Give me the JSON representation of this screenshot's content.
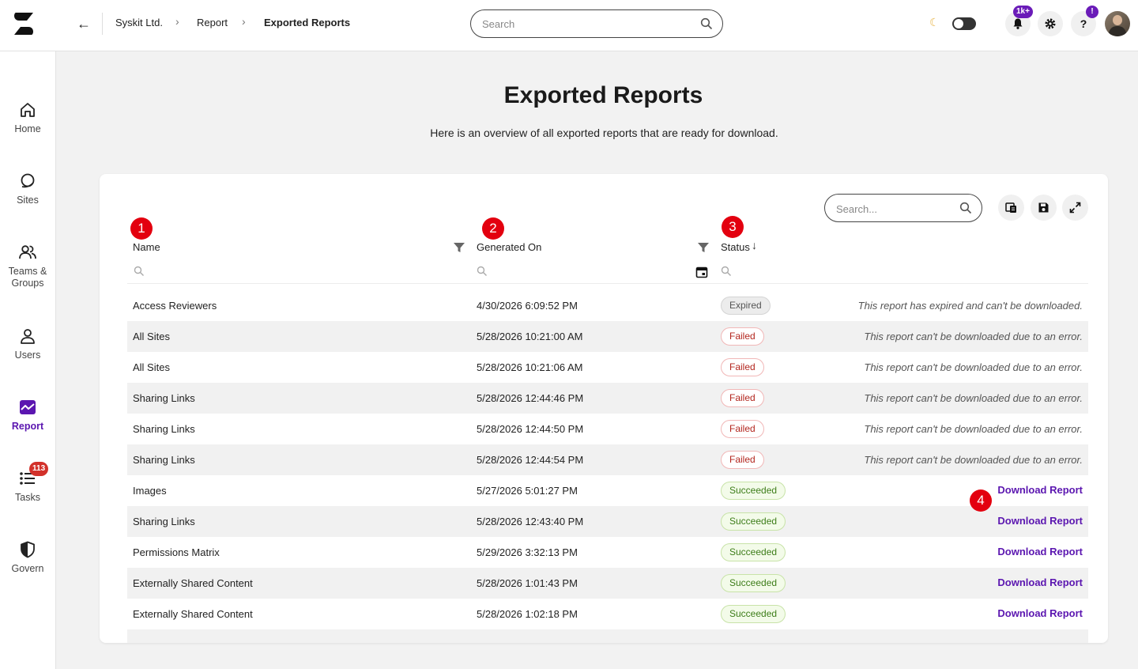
{
  "breadcrumb": {
    "items": [
      "Syskit Ltd.",
      "Report",
      "Exported Reports"
    ]
  },
  "topbar": {
    "search_placeholder": "Search",
    "notifications_badge": "1k+",
    "help_badge": "!",
    "theme": "dark-mode-toggle-off",
    "colors": {
      "accent": "#5b16b0",
      "badge": "#6a1bb8"
    }
  },
  "sidebar": {
    "items": [
      {
        "label": "Home",
        "icon": "home-icon",
        "active": false
      },
      {
        "label": "Sites",
        "icon": "sites-icon",
        "active": false
      },
      {
        "label": "Teams & Groups",
        "icon": "teams-groups-icon",
        "active": false
      },
      {
        "label": "Users",
        "icon": "user-icon",
        "active": false
      },
      {
        "label": "Report",
        "icon": "report-icon",
        "active": true
      },
      {
        "label": "Tasks",
        "icon": "tasks-icon",
        "active": false,
        "badge": "113"
      },
      {
        "label": "Govern",
        "icon": "shield-icon",
        "active": false
      }
    ]
  },
  "page": {
    "title": "Exported Reports",
    "subtitle": "Here is an overview of all exported reports that are ready for download."
  },
  "table": {
    "search_placeholder": "Search...",
    "toolbar_icons": [
      "export-columns-icon",
      "save-icon",
      "expand-icon"
    ],
    "columns": [
      {
        "label": "Name",
        "marker": "1"
      },
      {
        "label": "Generated On",
        "marker": "2"
      },
      {
        "label": "Status",
        "marker": "3",
        "sort": "descending"
      }
    ],
    "download_marker": "4",
    "rows": [
      {
        "name": "Access Reviewers",
        "date": "4/30/2026 6:09:52 PM",
        "status": "Expired",
        "message": "This report has expired and can't be downloaded."
      },
      {
        "name": "All Sites",
        "date": "5/28/2026 10:21:00 AM",
        "status": "Failed",
        "message": "This report can't be downloaded due to an error."
      },
      {
        "name": "All Sites",
        "date": "5/28/2026 10:21:06 AM",
        "status": "Failed",
        "message": "This report can't be downloaded due to an error."
      },
      {
        "name": "Sharing Links",
        "date": "5/28/2026 12:44:46 PM",
        "status": "Failed",
        "message": "This report can't be downloaded due to an error."
      },
      {
        "name": "Sharing Links",
        "date": "5/28/2026 12:44:50 PM",
        "status": "Failed",
        "message": "This report can't be downloaded due to an error."
      },
      {
        "name": "Sharing Links",
        "date": "5/28/2026 12:44:54 PM",
        "status": "Failed",
        "message": "This report can't be downloaded due to an error."
      },
      {
        "name": "Images",
        "date": "5/27/2026 5:01:27 PM",
        "status": "Succeeded",
        "action": "Download Report"
      },
      {
        "name": "Sharing Links",
        "date": "5/28/2026 12:43:40 PM",
        "status": "Succeeded",
        "action": "Download Report"
      },
      {
        "name": "Permissions Matrix",
        "date": "5/29/2026 3:32:13 PM",
        "status": "Succeeded",
        "action": "Download Report"
      },
      {
        "name": "Externally Shared Content",
        "date": "5/28/2026 1:01:43 PM",
        "status": "Succeeded",
        "action": "Download Report"
      },
      {
        "name": "Externally Shared Content",
        "date": "5/28/2026 1:02:18 PM",
        "status": "Succeeded",
        "action": "Download Report"
      }
    ]
  }
}
